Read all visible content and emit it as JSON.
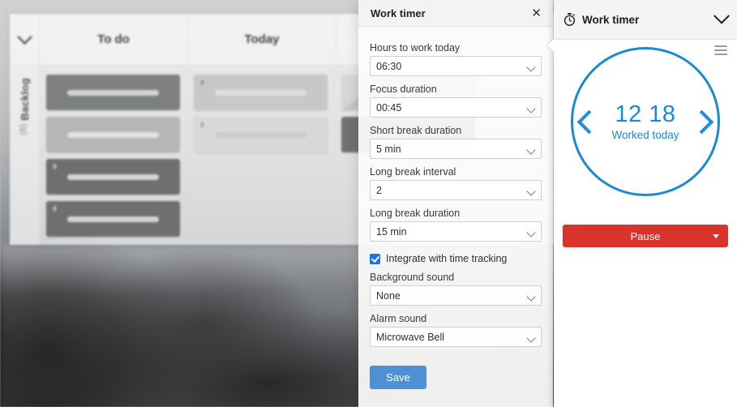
{
  "background_app": {
    "collapse_icon": "chevron-down-icon",
    "columns": [
      {
        "label": "To do"
      },
      {
        "label": "Today"
      }
    ],
    "swimlane": {
      "label": "Backlog",
      "count": "(8)"
    },
    "cards": {
      "todo": [
        {
          "tone": "dark",
          "badge": ""
        },
        {
          "tone": "mid",
          "badge": ""
        },
        {
          "tone": "darker",
          "badge": "arrow-down-icon"
        },
        {
          "tone": "darker",
          "badge": "arrow-down-icon"
        }
      ],
      "today": [
        {
          "tone": "light",
          "badge": "arrow-up-icon"
        },
        {
          "tone": "pale",
          "badge": "arrow-up-icon"
        }
      ]
    }
  },
  "settings_modal": {
    "title": "Work timer",
    "close_icon": "close-icon",
    "fields": [
      {
        "label": "Hours to work today",
        "value": "06:30",
        "name": "hours-to-work-today"
      },
      {
        "label": "Focus duration",
        "value": "00:45",
        "name": "focus-duration"
      },
      {
        "label": "Short break duration",
        "value": "5 min",
        "name": "short-break-duration"
      },
      {
        "label": "Long break interval",
        "value": "2",
        "name": "long-break-interval"
      },
      {
        "label": "Long break duration",
        "value": "15 min",
        "name": "long-break-duration"
      }
    ],
    "checkbox": {
      "label": "Integrate with time tracking",
      "checked": true
    },
    "sound_fields": [
      {
        "label": "Background sound",
        "value": "None",
        "name": "background-sound"
      },
      {
        "label": "Alarm sound",
        "value": "Microwave Bell",
        "name": "alarm-sound"
      }
    ],
    "save_label": "Save",
    "accent_color": "#4d90d4"
  },
  "timer_panel": {
    "title": "Work timer",
    "icon": "stopwatch-icon",
    "collapse_icon": "chevron-down-icon",
    "menu_icon": "hamburger-icon",
    "prev_icon": "chevron-left-icon",
    "next_icon": "chevron-right-icon",
    "timer_value": "12 18",
    "timer_caption": "Worked today",
    "accent_color": "#1a8ad6",
    "action": {
      "label": "Pause",
      "color": "#d9342b",
      "dropdown_icon": "caret-down-icon"
    }
  }
}
